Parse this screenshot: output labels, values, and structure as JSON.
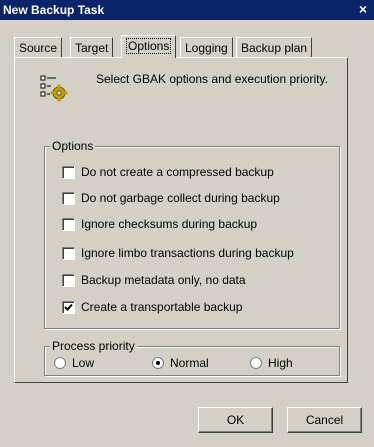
{
  "window": {
    "title": "New Backup Task",
    "close_glyph": "×"
  },
  "tabs": [
    {
      "label": "Source",
      "active": false
    },
    {
      "label": "Target",
      "active": false
    },
    {
      "label": "Options",
      "active": true
    },
    {
      "label": "Logging",
      "active": false
    },
    {
      "label": "Backup plan",
      "active": false
    }
  ],
  "header": {
    "icon": "gbak-options-icon",
    "text": "Select GBAK options and execution priority."
  },
  "options": {
    "legend": "Options",
    "items": [
      {
        "label": "Do not create a compressed backup",
        "checked": false
      },
      {
        "label": "Do not garbage collect during backup",
        "checked": false
      },
      {
        "label": "Ignore checksums during backup",
        "checked": false
      },
      {
        "label": "Ignore limbo transactions during backup",
        "checked": false
      },
      {
        "label": "Backup metadata only, no data",
        "checked": false
      },
      {
        "label": "Create a transportable backup",
        "checked": true
      }
    ]
  },
  "priority": {
    "legend": "Process priority",
    "items": [
      {
        "label": "Low",
        "selected": false
      },
      {
        "label": "Normal",
        "selected": true
      },
      {
        "label": "High",
        "selected": false
      }
    ]
  },
  "buttons": {
    "ok": "OK",
    "cancel": "Cancel"
  }
}
